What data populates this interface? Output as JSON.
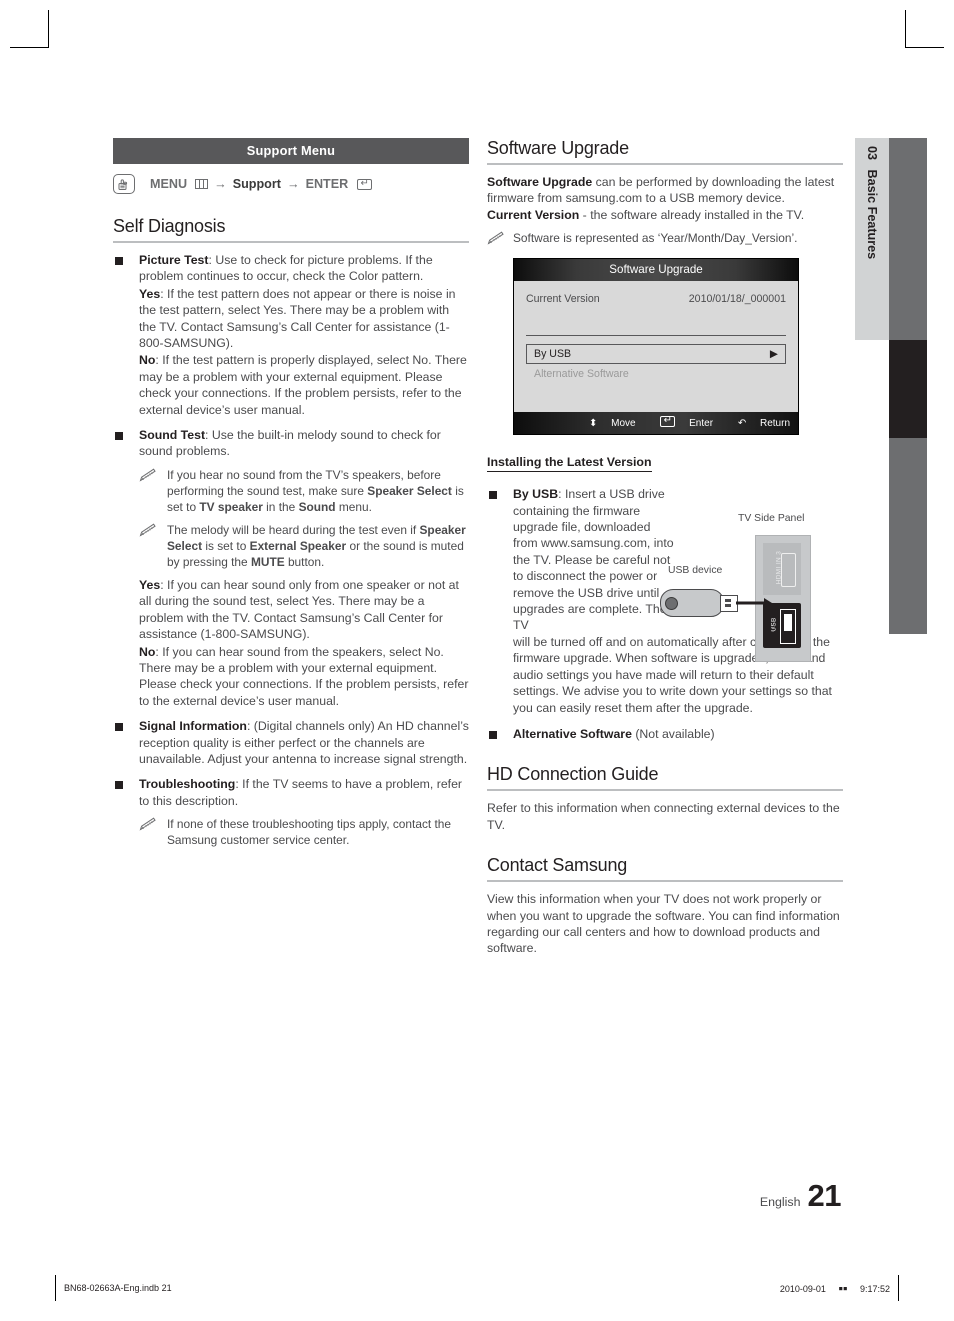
{
  "document": {
    "chapter_number": "03",
    "chapter_title": "Basic Features",
    "language": "English",
    "page_number": "21"
  },
  "print_footer": {
    "file": "BN68-02663A-Eng.indb   21",
    "date": "2010-09-01",
    "marker": "￭￭",
    "time": "9:17:52"
  },
  "left_column": {
    "menu_bar": {
      "title": "Support Menu",
      "remote_icon": "remote-button-icon",
      "path_menu": "MENU",
      "menu_glyph": "menu-grid-icon",
      "arrow1": "→",
      "path_support": "Support",
      "arrow2": "→",
      "path_enter": "ENTER",
      "enter_glyph": "enter-key-icon"
    },
    "section": {
      "heading": "Self Diagnosis",
      "items": [
        {
          "name": "picture-test",
          "paragraphs": [
            {
              "bold": "Picture Test",
              "text": ": Use to check for picture problems. If the problem continues to occur, check the Color pattern."
            },
            {
              "bold": "Yes",
              "text": ": If the test pattern does not appear or there is noise in the test pattern, select Yes. There may be a problem with the TV. Contact Samsung’s Call Center for assistance (1-800-SAMSUNG)."
            },
            {
              "bold": "No",
              "text": ": If the test pattern is properly displayed, select No. There may be a problem with your external equipment. Please check your connections. If the problem persists, refer to the external device’s user manual."
            }
          ],
          "notes": []
        },
        {
          "name": "sound-test",
          "paragraphs": [
            {
              "bold": "Sound Test",
              "text": ": Use the built-in melody sound to check for sound problems."
            }
          ],
          "notes": [
            "If you hear no sound from the TV’s speakers, before performing the sound test, make sure <b>Speaker Select</b> is set to <b>TV speaker</b> in the <b>Sound</b> menu.",
            "The melody will be heard during the test even if <b>Speaker Select</b> is set to <b>External Speaker</b> or the sound is muted by pressing the <b>MUTE</b> button."
          ],
          "paragraphs_after": [
            {
              "bold": "Yes",
              "text": ": If you can hear sound only from one speaker or not at all during the sound test, select Yes. There may be a problem with the TV. Contact Samsung’s Call Center for assistance (1-800-SAMSUNG)."
            },
            {
              "bold": "No",
              "text": ": If you can hear sound from the speakers, select No. There may be a problem with your external equipment. Please check your connections. If the problem persists, refer to the external device’s user manual."
            }
          ]
        },
        {
          "name": "signal-information",
          "paragraphs": [
            {
              "bold": "Signal Information",
              "text": ": (Digital channels only) An HD channel’s reception quality is either perfect or the channels are unavailable. Adjust your antenna to increase signal strength."
            }
          ],
          "notes": []
        },
        {
          "name": "troubleshooting",
          "paragraphs": [
            {
              "bold": "Troubleshooting",
              "text": ": If the TV seems to have a problem, refer to this description."
            }
          ],
          "notes": [
            "If none of these troubleshooting tips apply, contact the Samsung customer service center."
          ]
        }
      ]
    }
  },
  "right_column": {
    "software_upgrade": {
      "heading": "Software Upgrade",
      "intro_bold": "Software Upgrade",
      "intro_text": " can be performed by downloading the latest firmware from samsung.com to a USB memory device.",
      "current_bold": "Current Version",
      "current_text": " - the software already installed in the TV.",
      "note": "Software is represented as ‘Year/Month/Day_Version’."
    },
    "osd": {
      "title": "Software Upgrade",
      "row_label": "Current Version",
      "row_value": "2010/01/18/_000001",
      "item_selected": "By USB",
      "item_selected_arrow": "▶",
      "item_disabled": "Alternative Software",
      "footer": {
        "move_glyph": "⬍",
        "move": "Move",
        "enter_glyph": "enter-key-icon",
        "enter": "Enter",
        "return_glyph": "↶",
        "return": "Return"
      }
    },
    "installing": {
      "heading": "Installing the Latest Version",
      "by_usb_bold": "By USB",
      "by_usb_text_narrow": ": Insert a USB drive containing the firmware upgrade file, downloaded from www.samsung.com, into the TV. Please be careful not to disconnect the power or remove the USB drive until upgrades are complete. The TV",
      "by_usb_text_wide": "will be turned off and on automatically after completing the firmware upgrade. When software is upgraded, video and audio settings you have made will return to their default settings. We advise you to write down your settings so that you can easily reset them after the upgrade.",
      "alt_bold": "Alternative Software",
      "alt_text": " (Not available)"
    },
    "diagram": {
      "tv_side_panel_label": "TV Side Panel",
      "usb_device_label": "USB device",
      "hdmi_port_label": "HDMI IN 3",
      "usb_port_label": "USB"
    },
    "hd_connection": {
      "heading": "HD Connection Guide",
      "text": "Refer to this information when connecting external devices to the TV."
    },
    "contact": {
      "heading": "Contact Samsung",
      "text": "View this information when your TV does not work properly or when you want to upgrade the software. You can find information regarding our call centers and how to download products and software."
    }
  }
}
